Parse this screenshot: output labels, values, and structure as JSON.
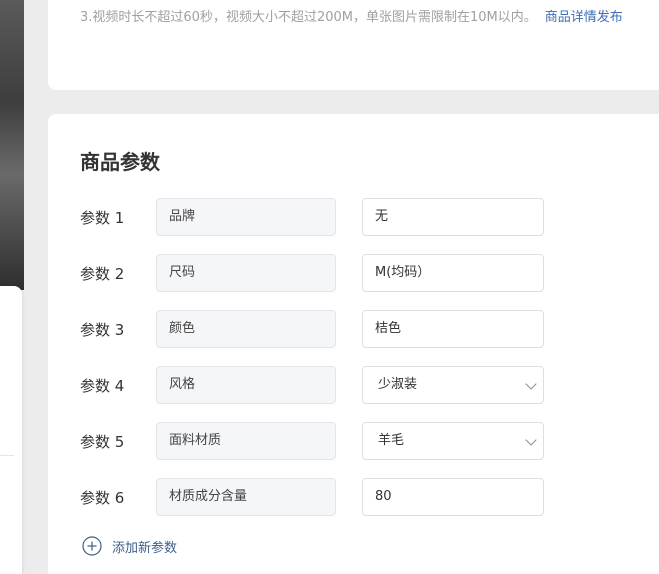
{
  "upload_note": {
    "text": "3.视频时长不超过60秒，视频大小不超过200M，单张图片需限制在10M以内。",
    "link": "商品详情发布"
  },
  "section": {
    "title": "商品参数"
  },
  "params": [
    {
      "label": "参数 1",
      "name": "品牌",
      "value": "无",
      "type": "text"
    },
    {
      "label": "参数 2",
      "name": "尺码",
      "value": "M(均码）",
      "type": "text"
    },
    {
      "label": "参数 3",
      "name": "颜色",
      "value": "桔色",
      "type": "text"
    },
    {
      "label": "参数 4",
      "name": "风格",
      "value": "少淑装",
      "type": "select"
    },
    {
      "label": "参数 5",
      "name": "面料材质",
      "value": "羊毛",
      "type": "select"
    },
    {
      "label": "参数 6",
      "name": "材质成分含量",
      "value": "80",
      "type": "text"
    }
  ],
  "add_param": {
    "label": "添加新参数",
    "icon": "plus-circle-icon"
  },
  "colors": {
    "link": "#3e6db5",
    "add_link": "#3e5d8c",
    "name_field_bg": "#f5f6f8"
  }
}
